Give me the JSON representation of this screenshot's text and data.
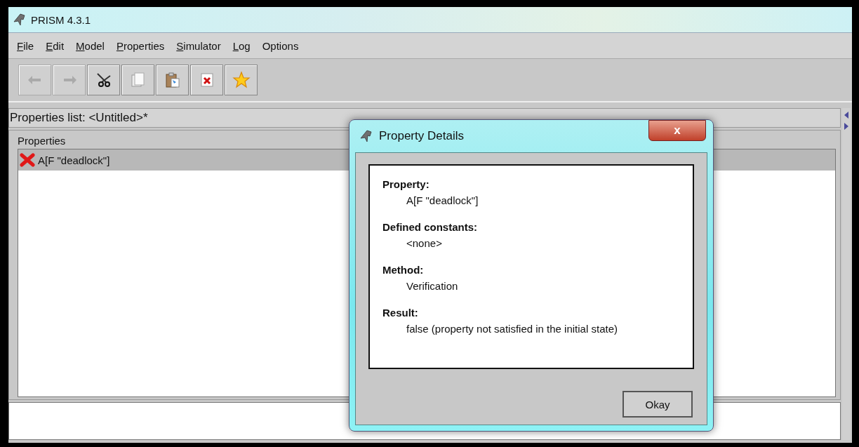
{
  "window": {
    "title": "PRISM 4.3.1"
  },
  "menu": [
    {
      "label": "File",
      "underline_first": true
    },
    {
      "label": "Edit",
      "underline_first": true
    },
    {
      "label": "Model",
      "underline_first": true
    },
    {
      "label": "Properties",
      "underline_first": true
    },
    {
      "label": "Simulator",
      "underline_first": true
    },
    {
      "label": "Log",
      "underline_first": true
    },
    {
      "label": "Options",
      "underline_first": false
    }
  ],
  "toolbar": [
    {
      "kind": "undo",
      "disabled": true
    },
    {
      "kind": "redo",
      "disabled": true
    },
    {
      "kind": "cut",
      "disabled": false
    },
    {
      "kind": "copy",
      "disabled": false
    },
    {
      "kind": "paste",
      "disabled": false
    },
    {
      "kind": "delete",
      "disabled": false
    },
    {
      "kind": "star",
      "disabled": false
    }
  ],
  "properties_list": {
    "title": "Properties list: <Untitled>*",
    "group_title": "Properties",
    "items": [
      {
        "text": "A[F \"deadlock\"]",
        "satisfied": false,
        "selected": true
      }
    ]
  },
  "dialog": {
    "title": "Property Details",
    "close_label": "x",
    "sections": [
      {
        "heading": "Property:",
        "value": "A[F \"deadlock\"]"
      },
      {
        "heading": "Defined constants:",
        "value": "<none>"
      },
      {
        "heading": "Method:",
        "value": "Verification"
      },
      {
        "heading": "Result:",
        "value": "false (property not satisfied in the initial state)"
      }
    ],
    "button": "Okay"
  }
}
